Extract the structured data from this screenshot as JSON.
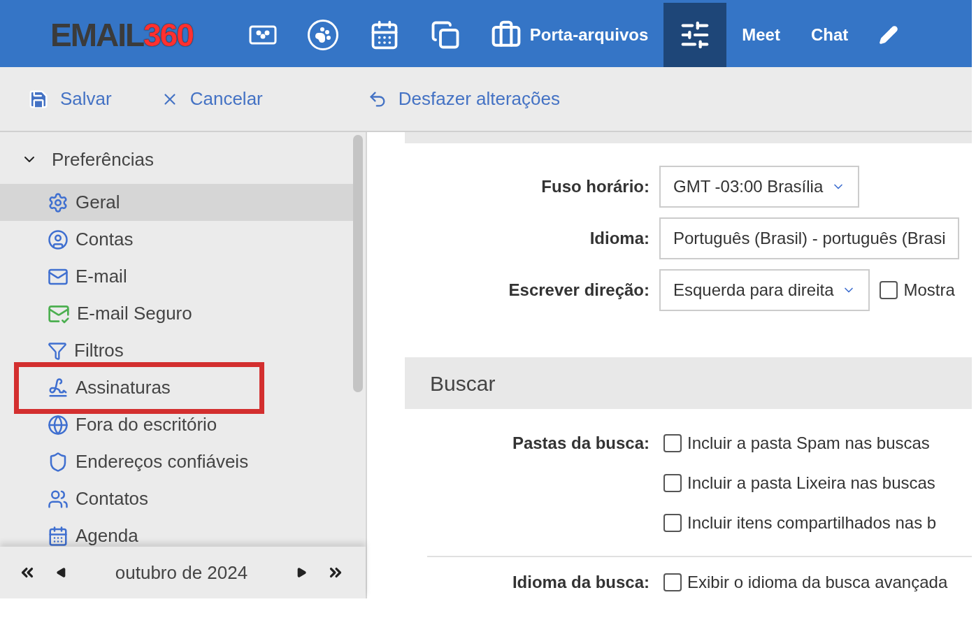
{
  "logo": {
    "word": "EMAIL",
    "number": "360"
  },
  "nav": [
    {
      "kind": "icon",
      "selected": false
    },
    {
      "kind": "icon",
      "selected": false
    },
    {
      "kind": "icon",
      "selected": false
    },
    {
      "kind": "icon",
      "selected": false
    },
    {
      "kind": "icon-label",
      "label": "Porta-arquivos",
      "selected": false
    },
    {
      "kind": "icon",
      "selected": true
    },
    {
      "kind": "label",
      "label": "Meet",
      "selected": false
    },
    {
      "kind": "label",
      "label": "Chat",
      "selected": false
    },
    {
      "kind": "icon",
      "selected": false
    }
  ],
  "toolbar": [
    "Salvar",
    "Cancelar",
    "Desfazer alterações"
  ],
  "sidebar": {
    "group": {
      "label": "Preferências",
      "expanded": true
    },
    "items": [
      {
        "label": "Geral",
        "selected": true,
        "highlighted": false
      },
      {
        "label": "Contas",
        "selected": false,
        "highlighted": false
      },
      {
        "label": "E-mail",
        "selected": false,
        "highlighted": false
      },
      {
        "label": "E-mail Seguro",
        "selected": false,
        "highlighted": false
      },
      {
        "label": "Filtros",
        "selected": false,
        "highlighted": false
      },
      {
        "label": "Assinaturas",
        "selected": false,
        "highlighted": true
      },
      {
        "label": "Fora do escritório",
        "selected": false,
        "highlighted": false
      },
      {
        "label": "Endereços confiáveis",
        "selected": false,
        "highlighted": false
      },
      {
        "label": "Contatos",
        "selected": false,
        "highlighted": false
      },
      {
        "label": "Agenda",
        "selected": false,
        "highlighted": false
      }
    ],
    "calendar_nav": {
      "month": "outubro de 2024"
    }
  },
  "general": {
    "fields": [
      {
        "kind": "select",
        "label": "Fuso horário:",
        "value": "GMT -03:00 Brasília"
      },
      {
        "kind": "text",
        "label": "Idioma:",
        "value": "Português (Brasil) - português (Brasi"
      },
      {
        "kind": "select",
        "label": "Escrever direção:",
        "value": "Esquerda para direita",
        "checkbox": {
          "label": "Mostra",
          "checked": false
        }
      }
    ]
  },
  "search": {
    "title": "Buscar",
    "folders": {
      "label": "Pastas da busca:",
      "options": [
        {
          "label": "Incluir a pasta Spam nas buscas",
          "checked": false
        },
        {
          "label": "Incluir a pasta Lixeira nas buscas",
          "checked": false
        },
        {
          "label": "Incluir itens compartilhados nas b",
          "checked": false
        }
      ]
    },
    "language": {
      "label": "Idioma da busca:",
      "option": {
        "label": "Exibir o idioma da busca avançada",
        "checked": false
      }
    }
  }
}
